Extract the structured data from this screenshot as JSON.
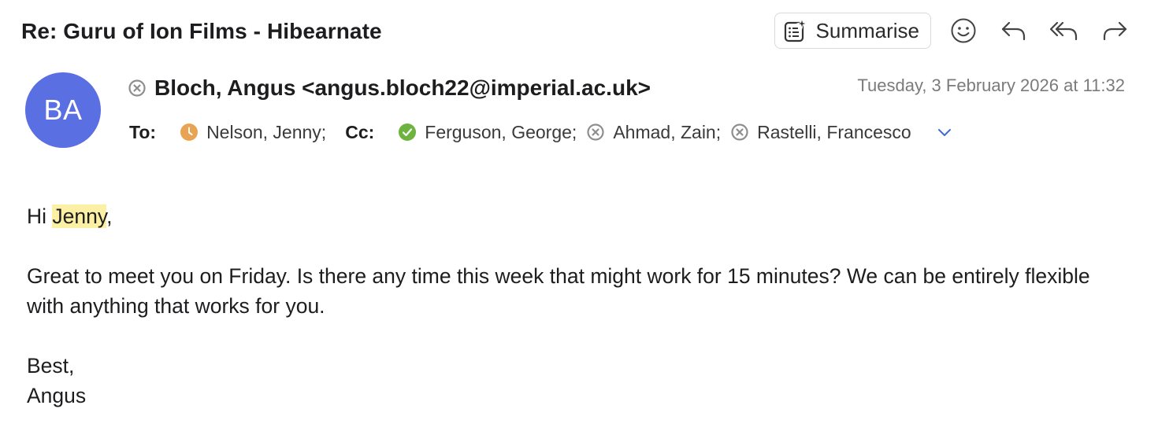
{
  "email": {
    "subject": "Re: Guru of Ion Films - Hibearnate",
    "toolbar": {
      "summarise_label": "Summarise",
      "icons": [
        "summarise-icon",
        "emoji-icon",
        "reply-icon",
        "reply-all-icon",
        "forward-icon"
      ]
    },
    "sender": {
      "initials": "BA",
      "name": "Bloch, Angus <angus.bloch22@imperial.ac.uk>",
      "avatar_color": "#5a6fe2",
      "status": "unavailable"
    },
    "date": "Tuesday, 3 February 2026 at 11:32",
    "to_label": "To:",
    "cc_label": "Cc:",
    "to": [
      {
        "name": "Nelson, Jenny;",
        "status": "away"
      }
    ],
    "cc": [
      {
        "name": "Ferguson, George;",
        "status": "available"
      },
      {
        "name": "Ahmad, Zain;",
        "status": "unavailable"
      },
      {
        "name": "Rastelli, Francesco",
        "status": "unavailable"
      }
    ],
    "status_colors": {
      "away": "#e8a453",
      "available": "#6cb33f",
      "unavailable": "#8e8e8e"
    },
    "body": {
      "greeting_prefix": "Hi ",
      "greeting_name": "Jenny",
      "greeting_suffix": ",",
      "paragraph": "Great to meet you on Friday. Is there any time this week that might work for 15 minutes? We can be entirely flexible with anything that works for you.",
      "signoff": "Best,",
      "signature": "Angus"
    }
  }
}
